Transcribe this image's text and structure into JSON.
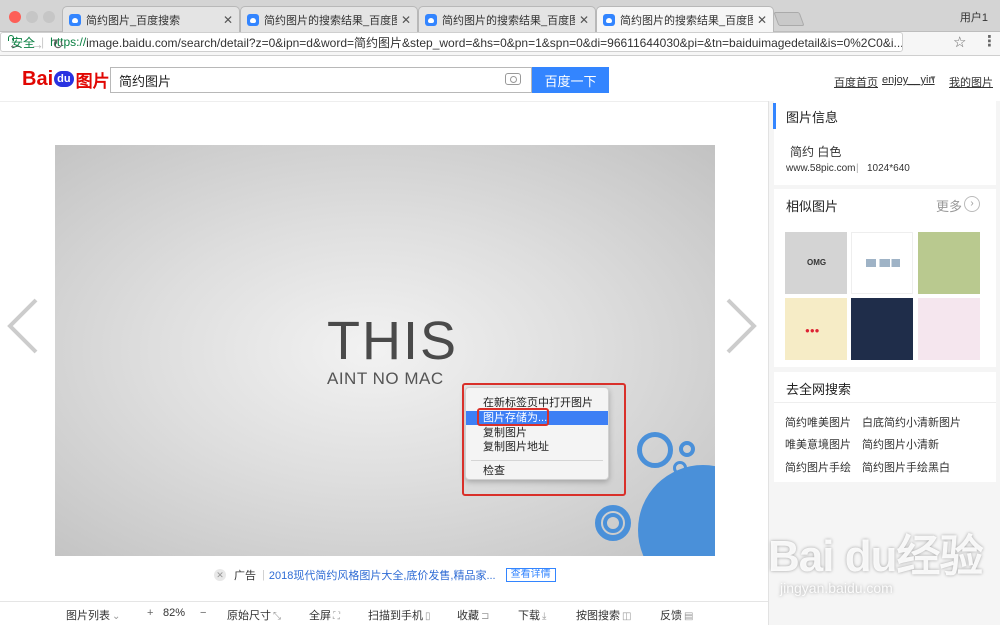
{
  "browser": {
    "tabs": [
      {
        "title": "简约图片_百度搜索"
      },
      {
        "title": "简约图片的搜索结果_百度图片搜"
      },
      {
        "title": "简约图片的搜索结果_百度图片搜"
      },
      {
        "title": "简约图片的搜索结果_百度图片搜"
      }
    ],
    "user_label": "用户1",
    "secure_label": "安全",
    "url_protocol": "https://",
    "url_rest": "image.baidu.com/search/detail?z=0&ipn=d&word=简约图片&step_word=&hs=0&pn=1&spn=0&di=96611644030&pi=&tn=baiduimagedetail&is=0%2C0&i..."
  },
  "header": {
    "logo_bai": "Bai",
    "logo_du": "du",
    "logo_pic": "图片",
    "search_value": "简约图片",
    "search_button": "百度一下",
    "links": [
      "百度首页",
      "enjoy__yin",
      "我的图片"
    ]
  },
  "image": {
    "title_big": "THIS",
    "title_small": "AINT NO MAC"
  },
  "context_menu": {
    "items": [
      "在新标签页中打开图片",
      "图片存储为...",
      "复制图片",
      "复制图片地址",
      "检查"
    ]
  },
  "ad": {
    "label": "广告",
    "text": "2018现代简约风格图片大全,底价发售,精品家...",
    "button": "查看详情"
  },
  "toolbar": {
    "list": "图片列表",
    "zoom": "82%",
    "original": "原始尺寸",
    "fullscreen": "全屏",
    "scan": "扫描到手机",
    "collect": "收藏",
    "download": "下载",
    "search_by": "按图搜索",
    "feedback": "反馈"
  },
  "side": {
    "info_title": "图片信息",
    "tags": "简约 白色",
    "source": "www.58pic.com",
    "size": "1024*640",
    "similar_title": "相似图片",
    "more": "更多",
    "thumb_text": [
      "OMG",
      "",
      "",
      "",
      "",
      "",
      ""
    ],
    "search_title": "去全网搜索",
    "related": [
      "简约唯美图片",
      "白底简约小清新图片",
      "唯美意境图片",
      "简约图片小清新",
      "简约图片手绘",
      "简约图片手绘黑白"
    ]
  },
  "watermark": {
    "big": "Bai du经验",
    "small": "jingyan.baidu.com"
  }
}
